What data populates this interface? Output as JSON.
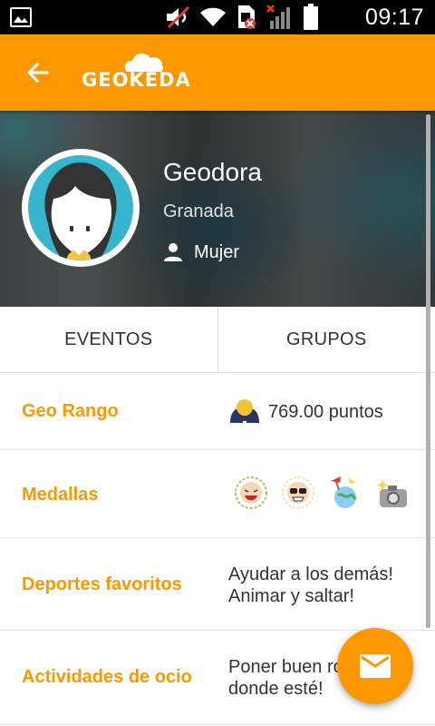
{
  "status_bar": {
    "time": "09:17",
    "icons": [
      "gallery-notification-icon",
      "volume-muted-icon",
      "wifi-icon",
      "sim-error-icon",
      "signal-no-service-icon",
      "battery-icon"
    ]
  },
  "app_bar": {
    "logo_text": "GEOKEDA",
    "back_icon": "arrow-back-icon"
  },
  "profile": {
    "name": "Geodora",
    "city": "Granada",
    "gender": "Mujer",
    "gender_icon": "person-icon"
  },
  "tabs": [
    {
      "label": "EVENTOS"
    },
    {
      "label": "GRUPOS"
    }
  ],
  "details": {
    "geo_rango": {
      "label": "Geo Rango",
      "value": "769.00 puntos"
    },
    "medallas": {
      "label": "Medallas",
      "medals": [
        "laughing-medal-icon",
        "sunglasses-medal-icon",
        "globe-medal-icon",
        "camera-medal-icon"
      ]
    },
    "deportes": {
      "label": "Deportes favoritos",
      "value": "Ayudar a los demás!\nAnimar y saltar!"
    },
    "ocio": {
      "label": "Actividades de ocio",
      "value": "Poner buen rollo\ndonde esté!"
    }
  },
  "fab": {
    "icon": "mail-icon"
  },
  "colors": {
    "accent": "#ff9800",
    "status_bar": "#000000",
    "text": "#333333"
  }
}
